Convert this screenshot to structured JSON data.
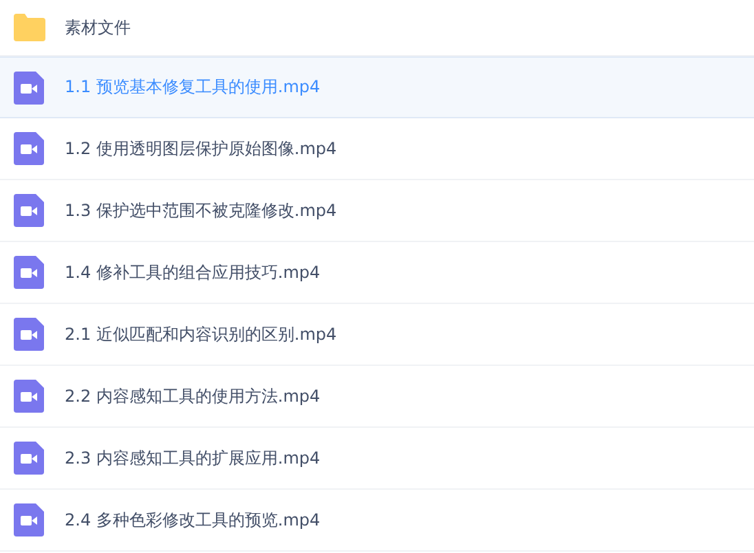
{
  "files": [
    {
      "kind": "folder",
      "name": "素材文件",
      "selected": false
    },
    {
      "kind": "video",
      "name": "1.1 预览基本修复工具的使用.mp4",
      "selected": true
    },
    {
      "kind": "video",
      "name": "1.2 使用透明图层保护原始图像.mp4",
      "selected": false
    },
    {
      "kind": "video",
      "name": "1.3 保护选中范围不被克隆修改.mp4",
      "selected": false
    },
    {
      "kind": "video",
      "name": "1.4 修补工具的组合应用技巧.mp4",
      "selected": false
    },
    {
      "kind": "video",
      "name": "2.1 近似匹配和内容识别的区别.mp4",
      "selected": false
    },
    {
      "kind": "video",
      "name": "2.2 内容感知工具的使用方法.mp4",
      "selected": false
    },
    {
      "kind": "video",
      "name": "2.3 内容感知工具的扩展应用.mp4",
      "selected": false
    },
    {
      "kind": "video",
      "name": "2.4 多种色彩修改工具的预览.mp4",
      "selected": false
    }
  ]
}
